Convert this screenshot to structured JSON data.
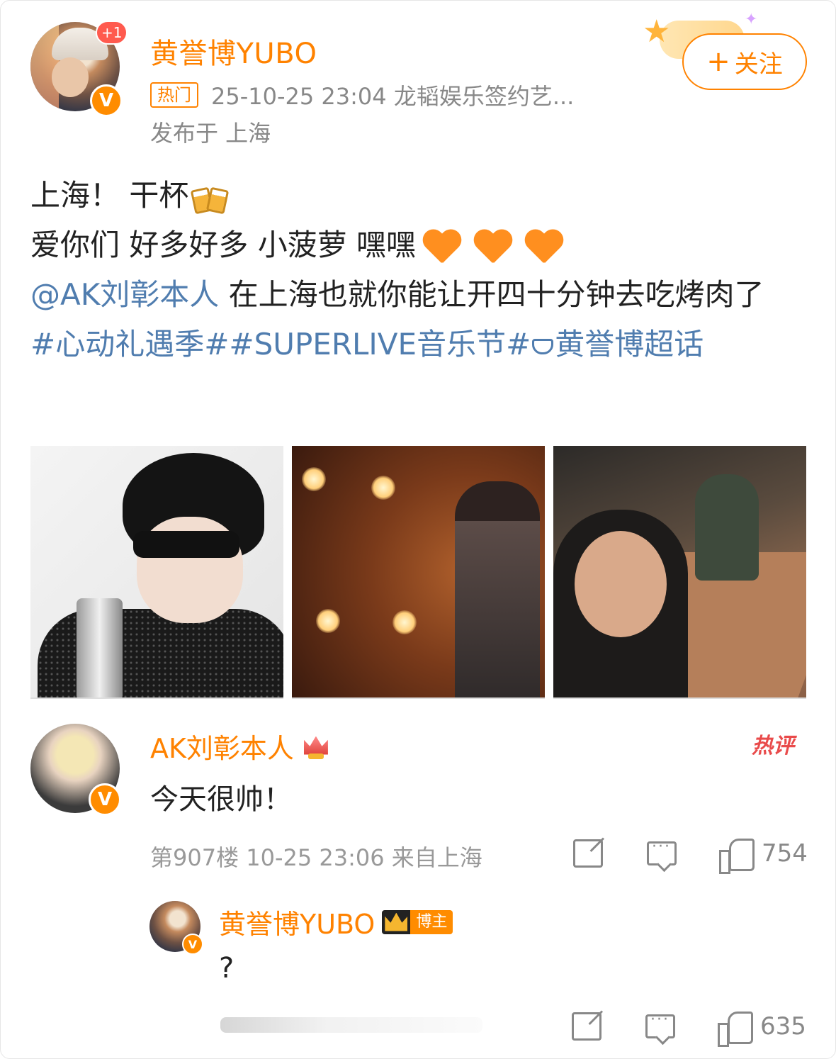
{
  "post": {
    "author": "黄誉博YUBO",
    "notification_count": "+1",
    "verified_mark": "V",
    "hot_tag": "热门",
    "meta": "25-10-25 23:04  龙韬娱乐签约艺...",
    "location": "发布于 上海",
    "follow_label": "关注",
    "follow_plus": "+",
    "super_deco_text": "超",
    "text": {
      "line1": "上海！ 干杯",
      "line2": "爱你们 好多好多 小菠萝 嘿嘿",
      "mention": "@AK刘彰本人",
      "line3_rest": " 在上海也就你能让开四十分钟去吃烤肉了",
      "topics_prefix": "#心动礼遇季##SUPERLIVE音乐节#",
      "topics_suffix": "黄誉博超话"
    }
  },
  "comment": {
    "author": "AK刘彰本人",
    "hot_label": "热评",
    "verified_mark": "V",
    "text": "今天很帅！",
    "meta": "第907楼 10-25 23:06 来自上海",
    "likes": "754"
  },
  "reply": {
    "author": "黄誉博YUBO",
    "blogger_badge": "博主",
    "verified_mark": "V",
    "text": "?",
    "likes": "635"
  },
  "colors": {
    "accent": "#ff8200",
    "link": "#507daf",
    "hot": "#e94b4b"
  }
}
